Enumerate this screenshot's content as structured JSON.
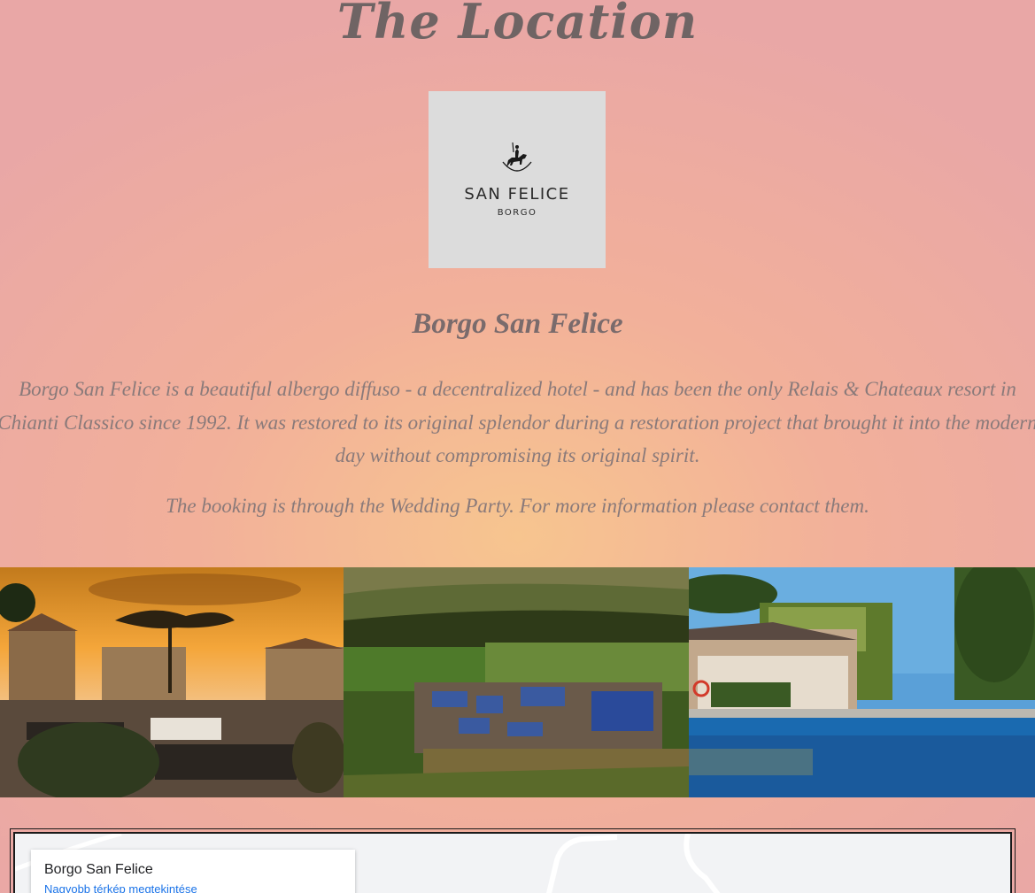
{
  "section": {
    "title": "The Location"
  },
  "logo": {
    "name": "SAN FELICE",
    "sub": "BORGO",
    "icon": "horse-rider-icon"
  },
  "venue": {
    "name": "Borgo San Felice",
    "description": "Borgo San Felice is a beautiful albergo diffuso - a decentralized hotel - and has been the only Relais & Chateaux resort in Chianti Classico since 1992. It was restored to its original splendor during a restoration project that brought it into the modern day without compromising its original spirit.",
    "booking_note": "The booking is through the Wedding Party. For more information please contact them."
  },
  "gallery": {
    "images": [
      {
        "subject": "sunset-wedding-dinner-photo"
      },
      {
        "subject": "aerial-village-photo"
      },
      {
        "subject": "hotel-pool-photo"
      }
    ]
  },
  "map": {
    "place_name": "Borgo San Felice",
    "larger_map_link": "Nagyobb térkép megtekintése"
  },
  "colors": {
    "background_center": "#f7c58f",
    "background_edge": "#e9a7a6",
    "title_text": "#6f6464",
    "body_text": "#8a7a7a",
    "map_link": "#1a73e8"
  }
}
